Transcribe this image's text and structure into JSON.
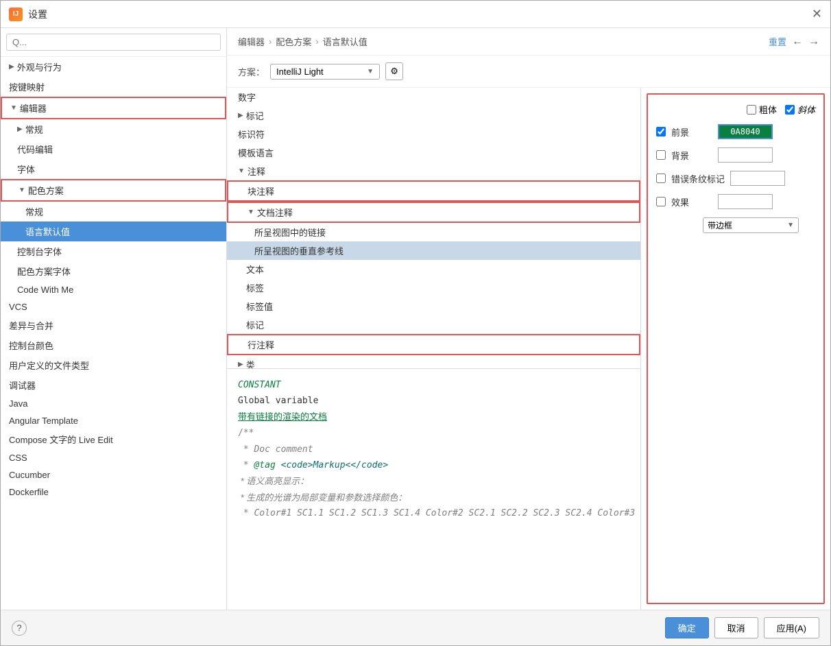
{
  "titleBar": {
    "title": "设置",
    "closeLabel": "✕"
  },
  "sidebar": {
    "searchPlaceholder": "Q...",
    "items": [
      {
        "id": "appearance",
        "label": "外观与行为",
        "indent": 0,
        "hasArrow": true,
        "arrowDir": "right",
        "selected": false,
        "bordered": false
      },
      {
        "id": "keymap",
        "label": "按键映射",
        "indent": 0,
        "hasArrow": false,
        "selected": false,
        "bordered": false
      },
      {
        "id": "editor",
        "label": "编辑器",
        "indent": 0,
        "hasArrow": true,
        "arrowDir": "down",
        "selected": false,
        "bordered": true
      },
      {
        "id": "general",
        "label": "常规",
        "indent": 1,
        "hasArrow": true,
        "arrowDir": "right",
        "selected": false,
        "bordered": false
      },
      {
        "id": "codeediting",
        "label": "代码编辑",
        "indent": 1,
        "hasArrow": false,
        "selected": false,
        "bordered": false
      },
      {
        "id": "font",
        "label": "字体",
        "indent": 1,
        "hasArrow": false,
        "selected": false,
        "bordered": false
      },
      {
        "id": "colorscheme",
        "label": "配色方案",
        "indent": 1,
        "hasArrow": true,
        "arrowDir": "down",
        "selected": false,
        "bordered": true
      },
      {
        "id": "colorscheme-general",
        "label": "常规",
        "indent": 2,
        "hasArrow": false,
        "selected": false,
        "bordered": false
      },
      {
        "id": "language-defaults",
        "label": "语言默认值",
        "indent": 2,
        "hasArrow": false,
        "selected": true,
        "bordered": false
      },
      {
        "id": "console-font",
        "label": "控制台字体",
        "indent": 1,
        "hasArrow": false,
        "selected": false,
        "bordered": false
      },
      {
        "id": "colorscheme-font",
        "label": "配色方案字体",
        "indent": 1,
        "hasArrow": false,
        "selected": false,
        "bordered": false
      },
      {
        "id": "codewithme",
        "label": "Code With Me",
        "indent": 1,
        "hasArrow": false,
        "selected": false,
        "bordered": false
      },
      {
        "id": "vcs",
        "label": "VCS",
        "indent": 0,
        "hasArrow": false,
        "selected": false,
        "bordered": false
      },
      {
        "id": "diff",
        "label": "差异与合并",
        "indent": 0,
        "hasArrow": false,
        "selected": false,
        "bordered": false
      },
      {
        "id": "console-color",
        "label": "控制台颜色",
        "indent": 0,
        "hasArrow": false,
        "selected": false,
        "bordered": false
      },
      {
        "id": "file-types",
        "label": "用户定义的文件类型",
        "indent": 0,
        "hasArrow": false,
        "selected": false,
        "bordered": false
      },
      {
        "id": "debugger",
        "label": "调试器",
        "indent": 0,
        "hasArrow": false,
        "selected": false,
        "bordered": false
      },
      {
        "id": "java",
        "label": "Java",
        "indent": 0,
        "hasArrow": false,
        "selected": false,
        "bordered": false
      },
      {
        "id": "angular",
        "label": "Angular Template",
        "indent": 0,
        "hasArrow": false,
        "selected": false,
        "bordered": false
      },
      {
        "id": "compose",
        "label": "Compose 文字的 Live Edit",
        "indent": 0,
        "hasArrow": false,
        "selected": false,
        "bordered": false
      },
      {
        "id": "css",
        "label": "CSS",
        "indent": 0,
        "hasArrow": false,
        "selected": false,
        "bordered": false
      },
      {
        "id": "cucumber",
        "label": "Cucumber",
        "indent": 0,
        "hasArrow": false,
        "selected": false,
        "bordered": false
      },
      {
        "id": "dockerfile",
        "label": "Dockerfile",
        "indent": 0,
        "hasArrow": false,
        "selected": false,
        "bordered": false
      }
    ]
  },
  "breadcrumb": {
    "items": [
      "编辑器",
      "配色方案",
      "语言默认值"
    ],
    "separator": "›",
    "resetLabel": "重置",
    "backLabel": "←",
    "forwardLabel": "→"
  },
  "scheme": {
    "label": "方案：",
    "value": "IntelliJ Light",
    "gearIcon": "⚙"
  },
  "itemsList": {
    "items": [
      {
        "id": "numbers",
        "label": "数字",
        "indent": 0,
        "hasArrow": false,
        "bordered": false,
        "selected": false
      },
      {
        "id": "markers",
        "label": "标记",
        "indent": 0,
        "hasArrow": true,
        "arrowDir": "right",
        "bordered": false,
        "selected": false
      },
      {
        "id": "identifiers",
        "label": "标识符",
        "indent": 0,
        "hasArrow": false,
        "bordered": false,
        "selected": false
      },
      {
        "id": "template-lang",
        "label": "模板语言",
        "indent": 0,
        "hasArrow": false,
        "bordered": false,
        "selected": false
      },
      {
        "id": "comments",
        "label": "注释",
        "indent": 0,
        "hasArrow": true,
        "arrowDir": "down",
        "bordered": false,
        "selected": false
      },
      {
        "id": "block-comment",
        "label": "块注释",
        "indent": 1,
        "hasArrow": false,
        "bordered": true,
        "selected": false
      },
      {
        "id": "doc-comment",
        "label": "文档注释",
        "indent": 1,
        "hasArrow": true,
        "arrowDir": "down",
        "bordered": true,
        "selected": false
      },
      {
        "id": "doc-link",
        "label": "所呈视图中的链接",
        "indent": 2,
        "hasArrow": false,
        "bordered": false,
        "selected": false
      },
      {
        "id": "doc-vline",
        "label": "所呈视图的垂直参考线",
        "indent": 2,
        "hasArrow": false,
        "bordered": false,
        "selected": true
      },
      {
        "id": "text",
        "label": "文本",
        "indent": 1,
        "hasArrow": false,
        "bordered": false,
        "selected": false
      },
      {
        "id": "tags",
        "label": "标签",
        "indent": 1,
        "hasArrow": false,
        "bordered": false,
        "selected": false
      },
      {
        "id": "tag-value",
        "label": "标签值",
        "indent": 1,
        "hasArrow": false,
        "bordered": false,
        "selected": false
      },
      {
        "id": "mark",
        "label": "标记",
        "indent": 1,
        "hasArrow": false,
        "bordered": false,
        "selected": false
      },
      {
        "id": "line-comment",
        "label": "行注释",
        "indent": 1,
        "hasArrow": false,
        "bordered": true,
        "selected": false
      },
      {
        "id": "class",
        "label": "类",
        "indent": 0,
        "hasArrow": true,
        "arrowDir": "right",
        "bordered": false,
        "selected": false
      }
    ]
  },
  "rightPanel": {
    "boldLabel": "粗体",
    "italicLabel": "斜体",
    "boldChecked": false,
    "italicChecked": true,
    "foregroundLabel": "前景",
    "foregroundChecked": true,
    "foregroundColor": "0A8040",
    "backgroundLabel": "背景",
    "backgroundChecked": false,
    "errorStripeLabel": "错误条纹标记",
    "errorStripeChecked": false,
    "effectLabel": "效果",
    "effectChecked": false,
    "effectSelectValue": "带边框",
    "effectSelectArrow": "▼"
  },
  "preview": {
    "line1": "CONSTANT",
    "line2": "Global variable",
    "line3": "带有链接的渲染的文档",
    "line4": "/**",
    "line5": " * Doc comment",
    "line6": " * @tag <code>Markup<</code>",
    "line7": " * 语义高亮显示：",
    "line8": " * 生成的光谱为局部变量和参数选择颜色：",
    "line9": " * Color#1 SC1.1 SC1.2 SC1.3 SC1.4 Color#2 SC2.1 SC2.2 SC2.3 SC2.4 Color#3"
  },
  "bottomBar": {
    "helpIcon": "?",
    "okLabel": "确定",
    "cancelLabel": "取消",
    "applyLabel": "应用(A)"
  }
}
